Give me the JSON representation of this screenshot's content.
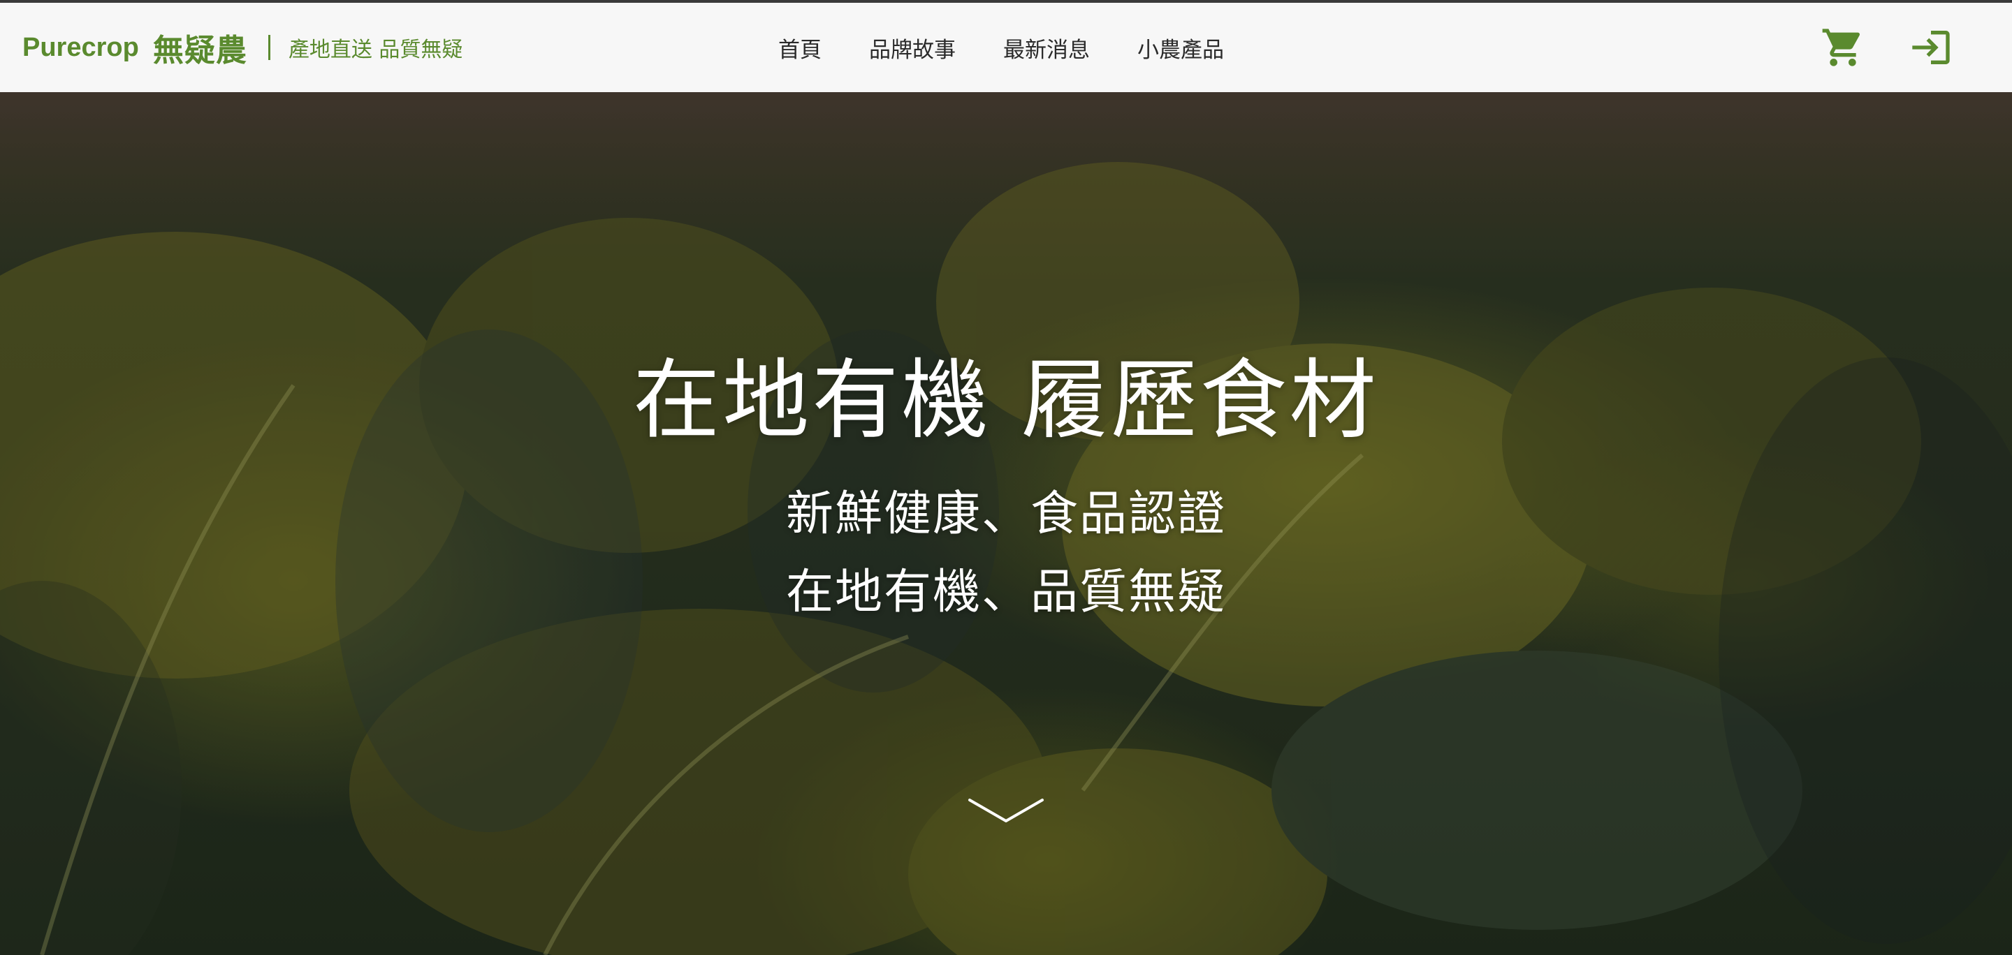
{
  "header": {
    "brand_name": "Purecrop",
    "brand_cn": "無疑農",
    "slogan": "產地直送 品質無疑",
    "accent_color": "#5a8a2e"
  },
  "nav": {
    "items": [
      {
        "label": "首頁"
      },
      {
        "label": "品牌故事"
      },
      {
        "label": "最新消息"
      },
      {
        "label": "小農產品"
      }
    ],
    "icons": [
      "cart-icon",
      "login-icon"
    ]
  },
  "hero": {
    "title": "在地有機 履歷食材",
    "subtitle_line1": "新鮮健康、食品認證",
    "subtitle_line2": "在地有機、品質無疑",
    "scroll_icon": "chevron-down-icon"
  }
}
